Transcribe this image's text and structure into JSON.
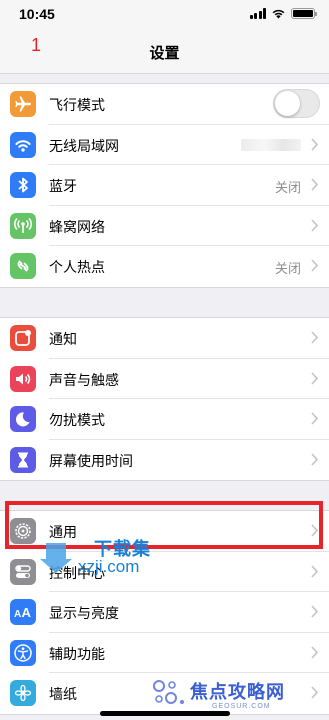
{
  "status_bar": {
    "time": "10:45"
  },
  "nav": {
    "title": "设置",
    "annotation": "1"
  },
  "groups": [
    {
      "rows": [
        {
          "label": "飞行模式",
          "icon": "airplane-icon",
          "color": "#f19a37",
          "accessory": "toggle",
          "toggle_on": false
        },
        {
          "label": "无线局域网",
          "icon": "wifi-icon",
          "color": "#2f7cf6",
          "accessory": "blurred"
        },
        {
          "label": "蓝牙",
          "icon": "bluetooth-icon",
          "color": "#2f7cf6",
          "value": "关闭"
        },
        {
          "label": "蜂窝网络",
          "icon": "antenna-icon",
          "color": "#65c466"
        },
        {
          "label": "个人热点",
          "icon": "hotspot-icon",
          "color": "#65c466",
          "value": "关闭"
        }
      ]
    },
    {
      "rows": [
        {
          "label": "通知",
          "icon": "notification-icon",
          "color": "#eb4d3d"
        },
        {
          "label": "声音与触感",
          "icon": "speaker-icon",
          "color": "#eb445a"
        },
        {
          "label": "勿扰模式",
          "icon": "moon-icon",
          "color": "#5e5ce6"
        },
        {
          "label": "屏幕使用时间",
          "icon": "hourglass-icon",
          "color": "#5e5ce6"
        }
      ]
    },
    {
      "rows": [
        {
          "label": "通用",
          "icon": "gear-icon",
          "color": "#8e8e93"
        },
        {
          "label": "控制中心",
          "icon": "toggles-icon",
          "color": "#8e8e93"
        },
        {
          "label": "显示与亮度",
          "icon": "text-size-icon",
          "color": "#2f7cf6"
        },
        {
          "label": "辅助功能",
          "icon": "accessibility-icon",
          "color": "#2f7cf6"
        },
        {
          "label": "墙纸",
          "icon": "wallpaper-icon",
          "color": "#35aadc"
        }
      ]
    }
  ],
  "watermarks": {
    "xiazai_title": "下载集",
    "xiazai_url": "xzji.com",
    "jiaodian_title": "焦点攻略网",
    "jiaodian_sub": "GEOSUR.COM"
  },
  "highlight_color": "#e6242a"
}
